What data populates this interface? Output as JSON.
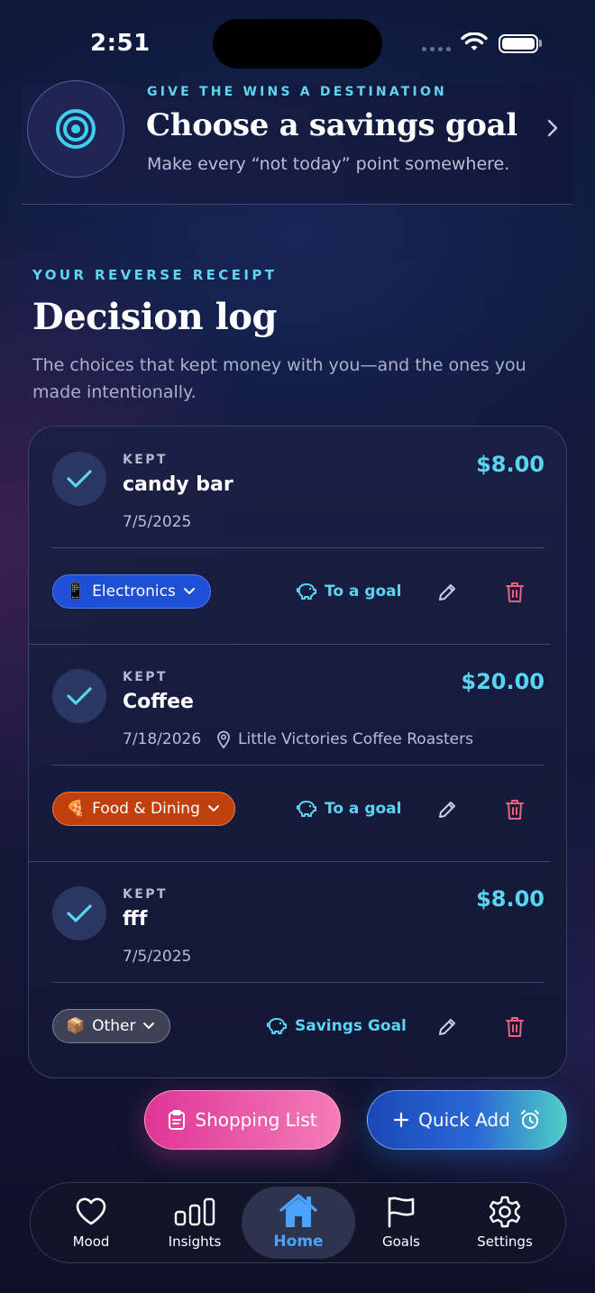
{
  "status_bar": {
    "time": "2:51"
  },
  "goal_banner": {
    "eyebrow": "GIVE THE WINS A DESTINATION",
    "title": "Choose a savings goal",
    "subtitle": "Make every “not today” point somewhere.",
    "icon": "target-icon"
  },
  "section": {
    "eyebrow": "YOUR REVERSE RECEIPT",
    "title": "Decision log",
    "description": "The choices that kept money with you—and the ones you made intentionally."
  },
  "entries": [
    {
      "status": "KEPT",
      "name": "candy bar",
      "date": "7/5/2025",
      "location": "",
      "amount": "$8.00",
      "category": {
        "label": "Electronics",
        "emoji": "📱",
        "color": "#1f4fd6"
      },
      "goal_link": "To a goal"
    },
    {
      "status": "KEPT",
      "name": "Coffee",
      "date": "7/18/2026",
      "location": "Little Victories Coffee Roasters",
      "amount": "$20.00",
      "category": {
        "label": "Food & Dining",
        "emoji": "🍕",
        "color": "#c0400d"
      },
      "goal_link": "To a goal"
    },
    {
      "status": "KEPT",
      "name": "fff",
      "date": "7/5/2025",
      "location": "",
      "amount": "$8.00",
      "category": {
        "label": "Other",
        "emoji": "📦",
        "color": "#3d4256"
      },
      "goal_link": "Savings Goal"
    }
  ],
  "actions": {
    "shopping_list": "Shopping List",
    "quick_add": "Quick Add"
  },
  "tabbar": {
    "tabs": [
      {
        "label": "Mood",
        "icon": "heart-icon"
      },
      {
        "label": "Insights",
        "icon": "bar-chart-icon"
      },
      {
        "label": "Home",
        "icon": "home-icon",
        "active": true
      },
      {
        "label": "Goals",
        "icon": "flag-icon"
      },
      {
        "label": "Settings",
        "icon": "gear-icon"
      }
    ]
  },
  "colors": {
    "accent_cyan": "#59d4f2",
    "home_active": "#4aa3ff",
    "delete_red": "#f0607a",
    "shopping_pink": "#e03597",
    "quick_blue": "#1b48b8"
  }
}
